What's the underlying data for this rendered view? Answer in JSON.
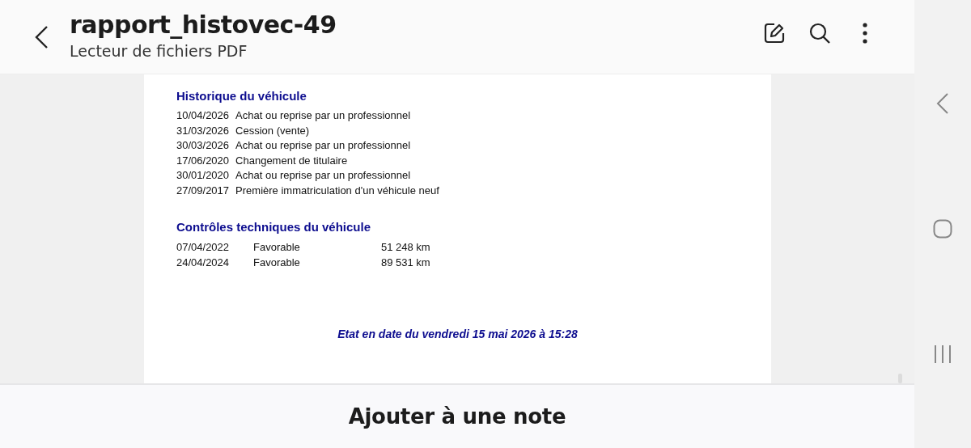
{
  "header": {
    "title": "rapport_histovec-49",
    "subtitle": "Lecteur de fichiers PDF"
  },
  "document": {
    "history": {
      "heading": "Historique du véhicule",
      "rows": [
        {
          "date": "10/04/2026",
          "event": "Achat ou reprise par un professionnel"
        },
        {
          "date": "31/03/2026",
          "event": "Cession (vente)"
        },
        {
          "date": "30/03/2026",
          "event": "Achat ou reprise par un professionnel"
        },
        {
          "date": "17/06/2020",
          "event": "Changement de titulaire"
        },
        {
          "date": "30/01/2020",
          "event": "Achat ou reprise par un professionnel"
        },
        {
          "date": "27/09/2017",
          "event": "Première immatriculation d'un véhicule neuf"
        }
      ]
    },
    "inspections": {
      "heading": "Contrôles techniques du véhicule",
      "rows": [
        {
          "date": "07/04/2022",
          "result": "Favorable",
          "mileage": "51 248 km"
        },
        {
          "date": "24/04/2024",
          "result": "Favorable",
          "mileage": "89 531 km"
        }
      ]
    },
    "footer": "Etat en date du vendredi 15 mai 2026 à 15:28"
  },
  "bottom_bar": {
    "button": "Ajouter à une note"
  }
}
